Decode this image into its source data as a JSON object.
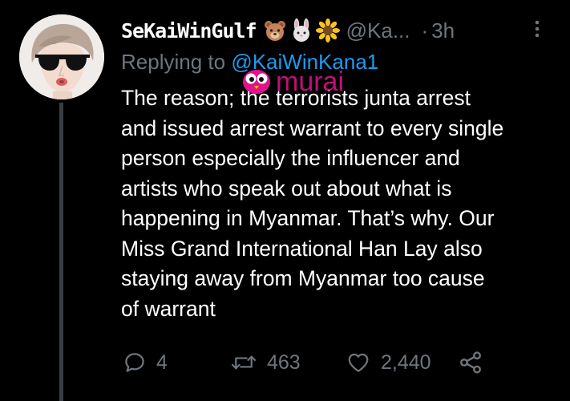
{
  "tweet": {
    "display_name": "SeKaiWinGulf",
    "name_emojis": [
      "bear-emoji",
      "rabbit-emoji",
      "sunflower-emoji"
    ],
    "handle": "@Ka...",
    "dot": "·",
    "time": "3h",
    "replying_prefix": "Replying to ",
    "replying_to": "@KaiWinKana1",
    "text": "The reason; the terrorists junta arrest and issued arrest warrant to every single person especially the influencer and artists who speak out about what is happening in Myanmar. That’s why. Our Miss Grand International Han Lay also staying away from Myanmar too cause of warrant",
    "lines": [
      "The reason; the terrorists junta arrest",
      "and issued arrest warrant to every single",
      "person especially the influencer and",
      "artists who speak out about what is",
      "happening in Myanmar. That’s why. Our",
      "Miss Grand International Han Lay also",
      "staying away from Myanmar too cause",
      "of warrant"
    ],
    "actions": {
      "replies": "4",
      "retweets": "463",
      "likes": "2,440"
    },
    "more_icon": "more-vertical-icon"
  },
  "watermark": {
    "text": "murai"
  },
  "colors": {
    "background": "#000000",
    "text": "#ffffff",
    "secondary": "#6e767d",
    "mention": "#1d9bf0",
    "thread_line": "#3a3d41",
    "watermark": "#e0138c"
  }
}
